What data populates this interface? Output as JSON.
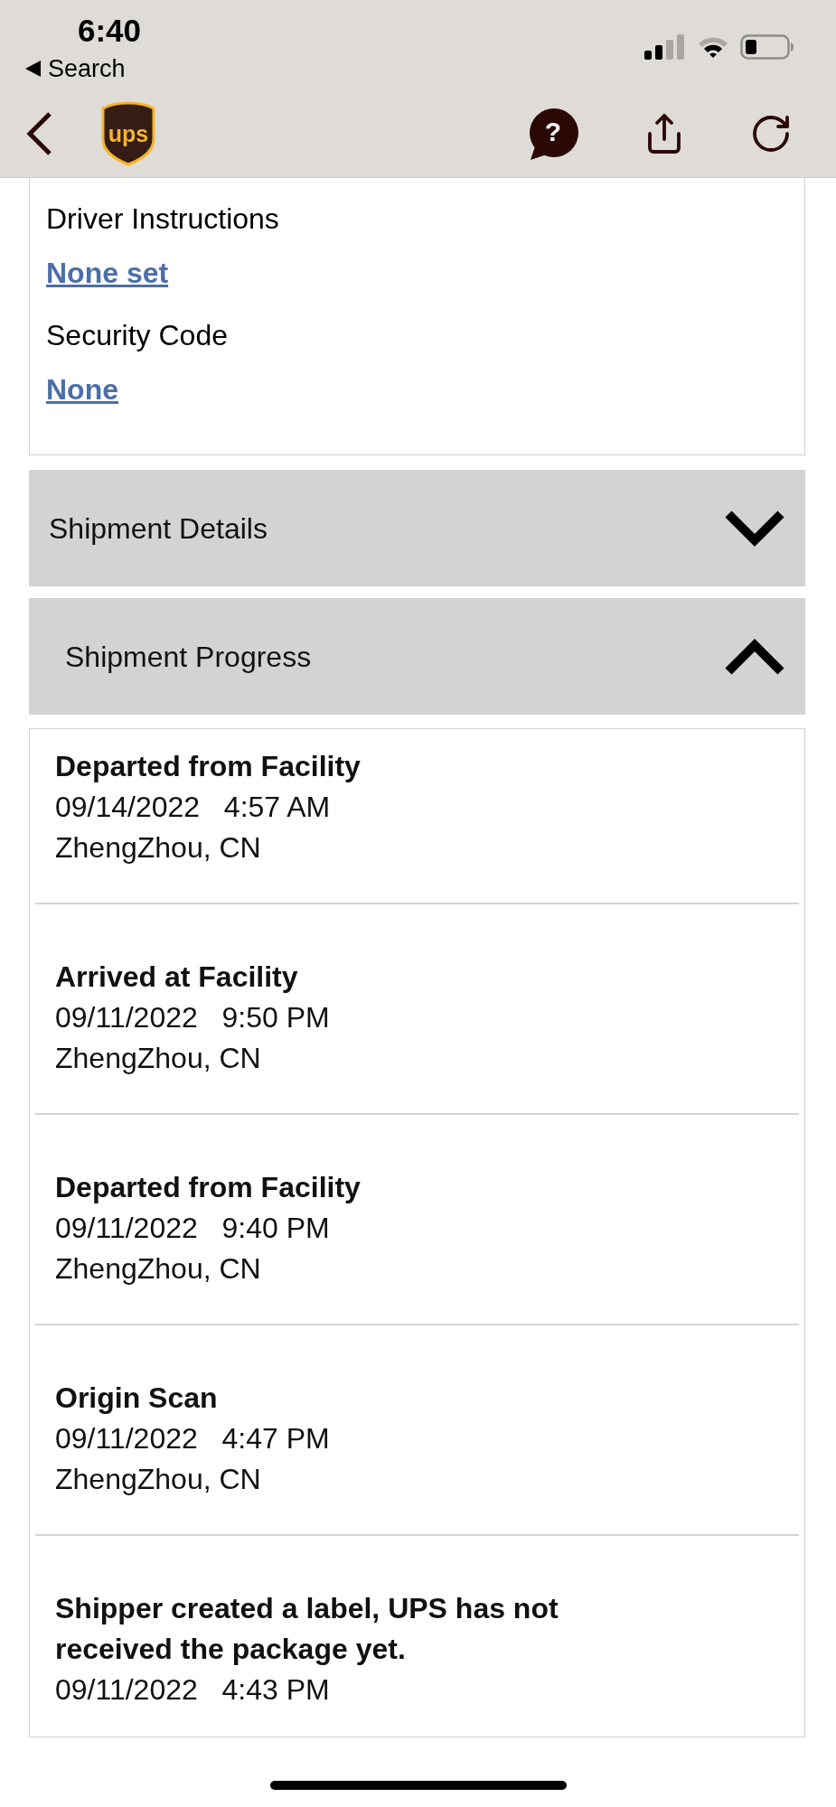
{
  "status_bar": {
    "time": "6:40",
    "back_link": "Search"
  },
  "nav_bar": {
    "logo_text": "ups",
    "help_glyph": "?"
  },
  "delivery_options": [
    {
      "label": "Driver Instructions",
      "value": "None set"
    },
    {
      "label": "Security Code",
      "value": "None"
    }
  ],
  "sections": [
    {
      "title": "Shipment Details",
      "expanded": false
    },
    {
      "title": "Shipment Progress",
      "expanded": true,
      "events": [
        {
          "status": "Departed from Facility",
          "datetime": "09/14/2022   4:57 AM",
          "location": "ZhengZhou, CN"
        },
        {
          "status": "Arrived at Facility",
          "datetime": "09/11/2022   9:50 PM",
          "location": "ZhengZhou, CN"
        },
        {
          "status": "Departed from Facility",
          "datetime": "09/11/2022   9:40 PM",
          "location": "ZhengZhou, CN"
        },
        {
          "status": "Origin Scan",
          "datetime": "09/11/2022   4:47 PM",
          "location": "ZhengZhou, CN"
        },
        {
          "status": "Shipper created a label, UPS has not received the package yet.",
          "datetime": "09/11/2022   4:43 PM"
        }
      ]
    }
  ]
}
